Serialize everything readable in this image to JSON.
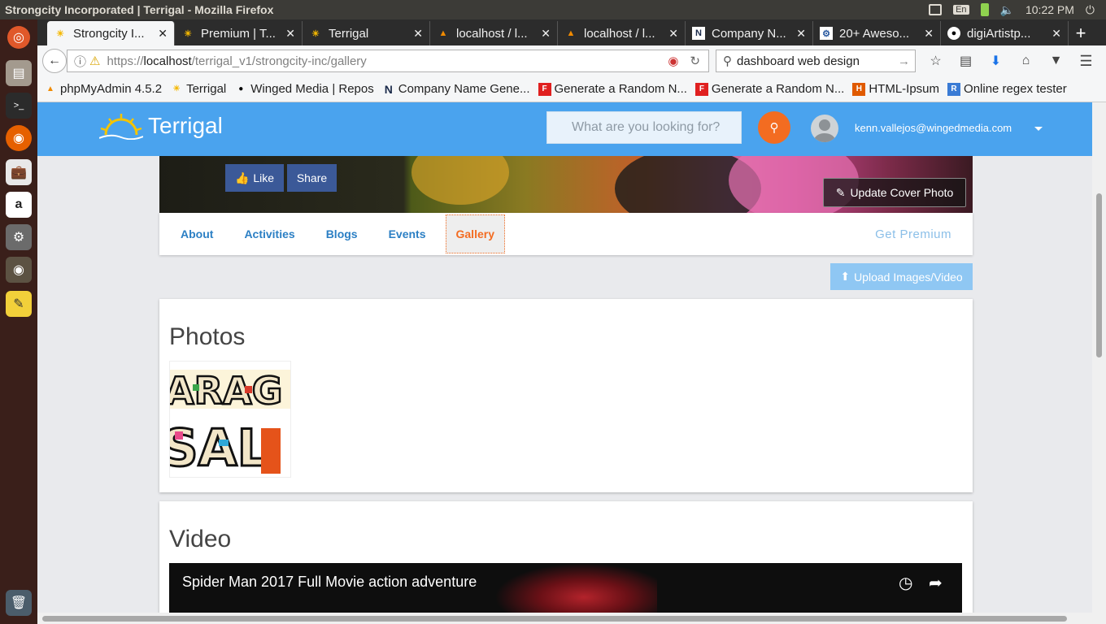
{
  "os": {
    "window_title": "Strongcity Incorporated | Terrigal - Mozilla Firefox",
    "keyboard": "En",
    "time": "10:22 PM"
  },
  "tabs": [
    {
      "label": "Strongcity I...",
      "icon": "sun-icon",
      "active": true
    },
    {
      "label": "Premium | T...",
      "icon": "sun-icon"
    },
    {
      "label": "Terrigal",
      "icon": "sun-icon"
    },
    {
      "label": "localhost / l...",
      "icon": "pma-icon"
    },
    {
      "label": "localhost / l...",
      "icon": "pma-icon"
    },
    {
      "label": "Company N...",
      "icon": "n-logo-icon"
    },
    {
      "label": "20+ Aweso...",
      "icon": "gear-icon"
    },
    {
      "label": "digiArtistp...",
      "icon": "github-icon"
    }
  ],
  "navbar": {
    "url_prefix": "https://",
    "url_host": "localhost",
    "url_path": "/terrigal_v1/strongcity-inc/gallery",
    "search_value": "dashboard web design"
  },
  "bookmarks": [
    {
      "label": "phpMyAdmin 4.5.2",
      "icon": "pma-icon"
    },
    {
      "label": "Terrigal",
      "icon": "sun-icon"
    },
    {
      "label": "Winged Media | Repos",
      "icon": "github-icon"
    },
    {
      "label": "Company Name Gene...",
      "icon": "n-logo-icon"
    },
    {
      "label": "Generate a Random N...",
      "icon": "f-icon"
    },
    {
      "label": "Generate a Random N...",
      "icon": "f-icon"
    },
    {
      "label": "HTML-Ipsum",
      "icon": "h-icon"
    },
    {
      "label": "Online regex tester",
      "icon": "r-icon"
    }
  ],
  "site": {
    "brand": "Terrigal",
    "search_placeholder": "What are you looking for?",
    "user_email": "kenn.vallejos@wingedmedia.com",
    "accent": "#4aa3ee",
    "action_color": "#f36c21"
  },
  "cover": {
    "like_label": "Like",
    "share_label": "Share",
    "update_label": "Update Cover Photo"
  },
  "subnav": {
    "items": [
      "About",
      "Activities",
      "Blogs",
      "Events",
      "Gallery"
    ],
    "active": "Gallery",
    "premium_label": "Get Premium"
  },
  "gallery": {
    "upload_label": "Upload Images/Video",
    "photos_heading": "Photos",
    "photo_text_top": "ARAG",
    "photo_text_bottom": "SAL",
    "video_heading": "Video",
    "video_title": "Spider Man 2017 Full Movie action adventure"
  }
}
